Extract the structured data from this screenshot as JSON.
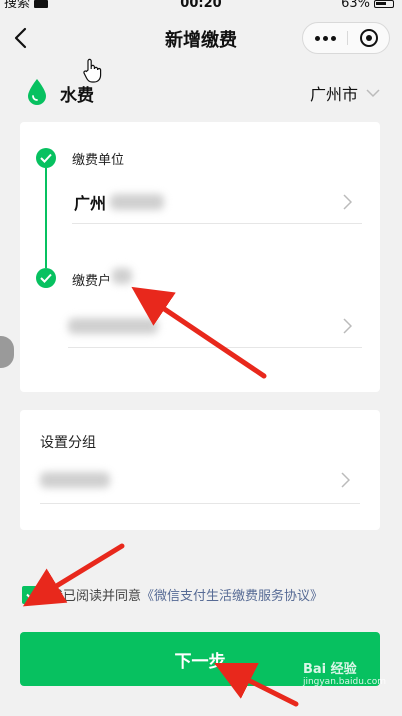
{
  "status_bar": {
    "carrier": "搜索",
    "time": "00:20",
    "battery": "63%"
  },
  "nav": {
    "title": "新增缴费"
  },
  "section": {
    "title": "水费",
    "city": "广州市"
  },
  "form": {
    "steps": [
      {
        "label": "缴费单位",
        "value": "广州"
      },
      {
        "label": "缴费户",
        "value": ""
      }
    ],
    "group_label": "设置分组"
  },
  "agreement": {
    "text": "我已阅读并同意",
    "link": "《微信支付生活缴费服务协议》",
    "checked": true
  },
  "next_button": "下一步",
  "watermark": {
    "text": "Bai 经验",
    "sub": "jingyan.baidu.com"
  },
  "colors": {
    "accent": "#07c160",
    "link": "#576b95",
    "background": "#f1f1f1"
  }
}
